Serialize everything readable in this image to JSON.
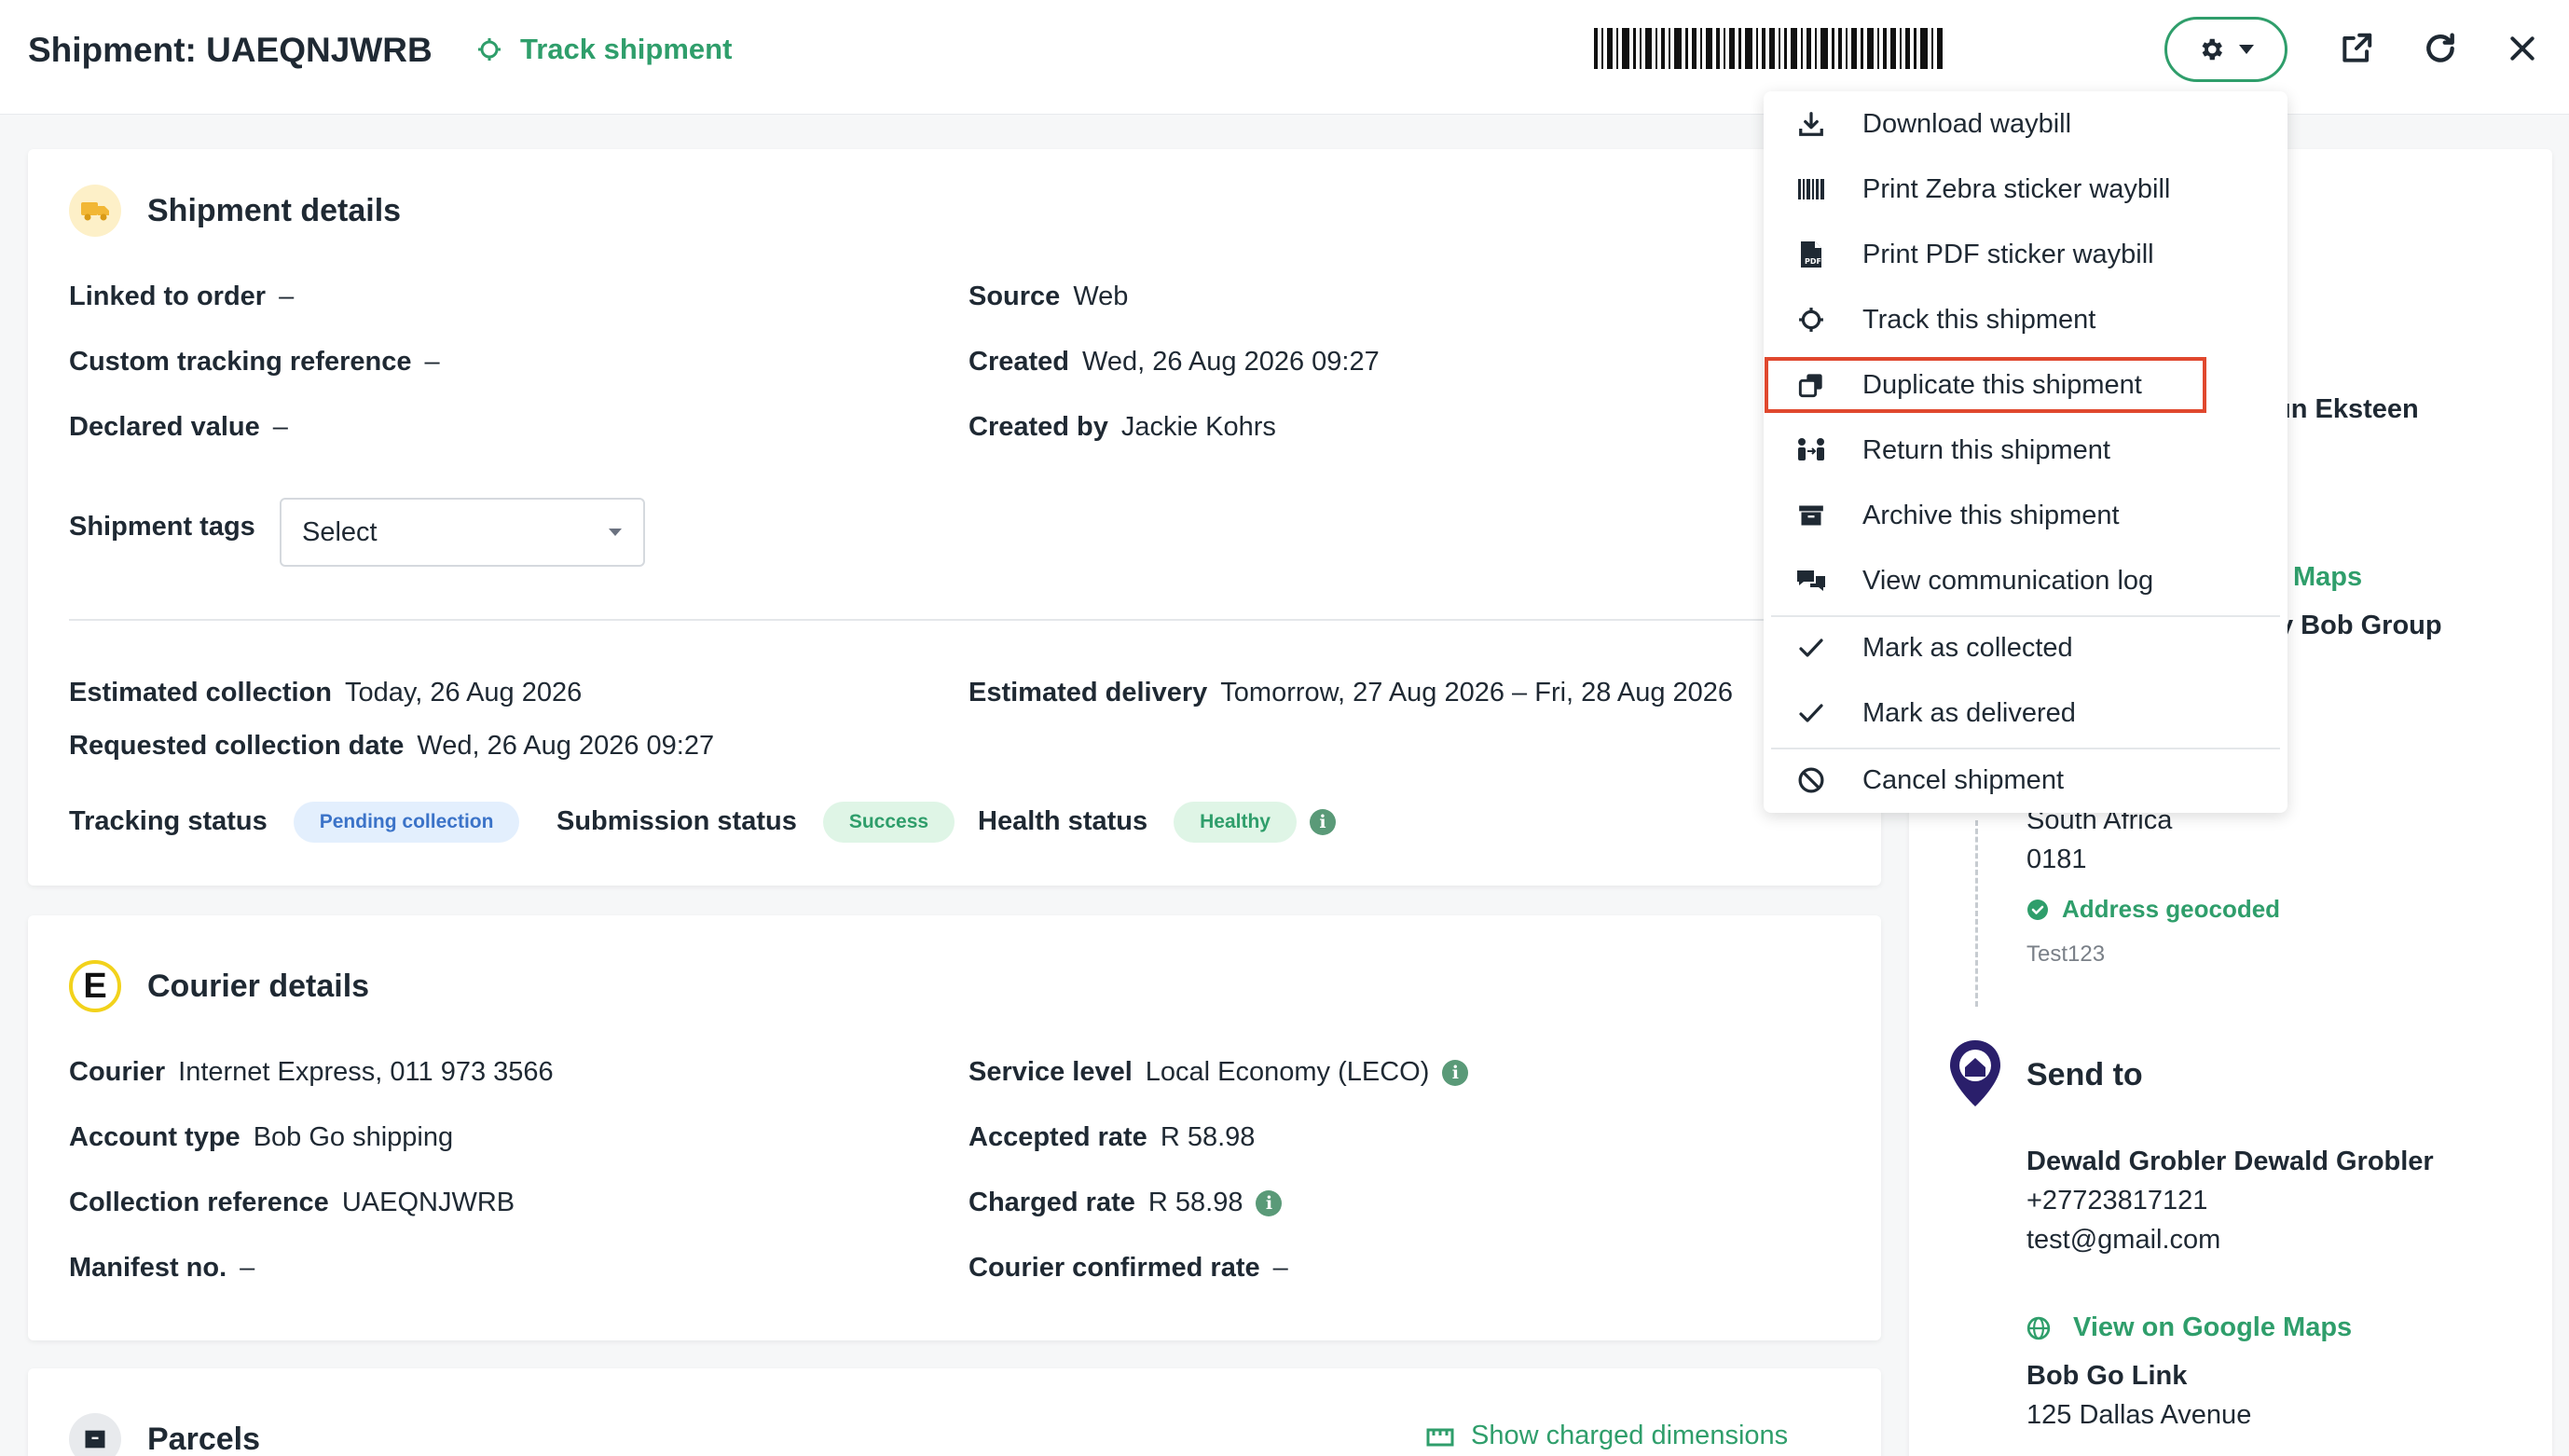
{
  "header": {
    "title": "Shipment: UAEQNJWRB",
    "track_label": "Track shipment"
  },
  "colors": {
    "accent": "#2f9e6b",
    "highlight": "#e0482e",
    "pending_bg": "#e3effd",
    "success_bg": "#dff5e6"
  },
  "icons": {
    "settings": "gear-icon",
    "open_external": "external-link-icon",
    "refresh": "refresh-icon",
    "close": "close-icon"
  },
  "shipment_details": {
    "title": "Shipment details",
    "linked_to_order": {
      "label": "Linked to order",
      "value": "–"
    },
    "custom_tracking_reference": {
      "label": "Custom tracking reference",
      "value": "–"
    },
    "declared_value": {
      "label": "Declared value",
      "value": "–"
    },
    "source": {
      "label": "Source",
      "value": "Web"
    },
    "created": {
      "label": "Created",
      "value": "Wed, 26 Aug 2026 09:27"
    },
    "created_by": {
      "label": "Created by",
      "value": "Jackie Kohrs"
    },
    "shipment_tags": {
      "label": "Shipment tags",
      "value": "Select"
    },
    "estimated_collection": {
      "label": "Estimated collection",
      "value": "Today, 26 Aug 2026"
    },
    "estimated_delivery": {
      "label": "Estimated delivery",
      "value": "Tomorrow, 27 Aug 2026 – Fri, 28 Aug 2026"
    },
    "requested_collection_date": {
      "label": "Requested collection date",
      "value": "Wed, 26 Aug 2026 09:27"
    },
    "tracking_status": {
      "label": "Tracking status",
      "value": "Pending collection"
    },
    "submission_status": {
      "label": "Submission status",
      "value": "Success"
    },
    "health_status": {
      "label": "Health status",
      "value": "Healthy"
    }
  },
  "courier_details": {
    "title": "Courier details",
    "courier": {
      "label": "Courier",
      "value": "Internet Express, 011 973 3566"
    },
    "account_type": {
      "label": "Account type",
      "value": "Bob Go shipping"
    },
    "collection_reference": {
      "label": "Collection reference",
      "value": "UAEQNJWRB"
    },
    "manifest_no": {
      "label": "Manifest no.",
      "value": "–"
    },
    "service_level": {
      "label": "Service level",
      "value": "Local Economy (LECO)"
    },
    "accepted_rate": {
      "label": "Accepted rate",
      "value": "R 58.98"
    },
    "charged_rate": {
      "label": "Charged rate",
      "value": "R 58.98"
    },
    "courier_confirmed_rate": {
      "label": "Courier confirmed rate",
      "value": "–"
    }
  },
  "parcels": {
    "title": "Parcels",
    "show_charged_dimensions": "Show charged dimensions"
  },
  "menu": {
    "items": [
      {
        "label": "Download waybill"
      },
      {
        "label": "Print Zebra sticker waybill"
      },
      {
        "label": "Print PDF sticker waybill"
      },
      {
        "label": "Track this shipment"
      },
      {
        "label": "Duplicate this shipment"
      },
      {
        "label": "Return this shipment"
      },
      {
        "label": "Archive this shipment"
      },
      {
        "label": "View communication log"
      },
      {
        "label": "Mark as collected"
      },
      {
        "label": "Mark as delivered"
      },
      {
        "label": "Cancel shipment"
      }
    ]
  },
  "sidebar": {
    "collect_name_partial": "un Eksteen",
    "maps_partial": "Maps",
    "company_partial": "y Bob Group",
    "country": "South Africa",
    "postal_code": "0181",
    "geocoded": "Address geocoded",
    "note": "Test123",
    "send_to_title": "Send to",
    "recipient_name": "Dewald Grobler Dewald Grobler",
    "recipient_phone": "+27723817121",
    "recipient_email": "test@gmail.com",
    "view_maps": "View on Google Maps",
    "company": "Bob Go Link",
    "address_line": "125 Dallas Avenue"
  }
}
